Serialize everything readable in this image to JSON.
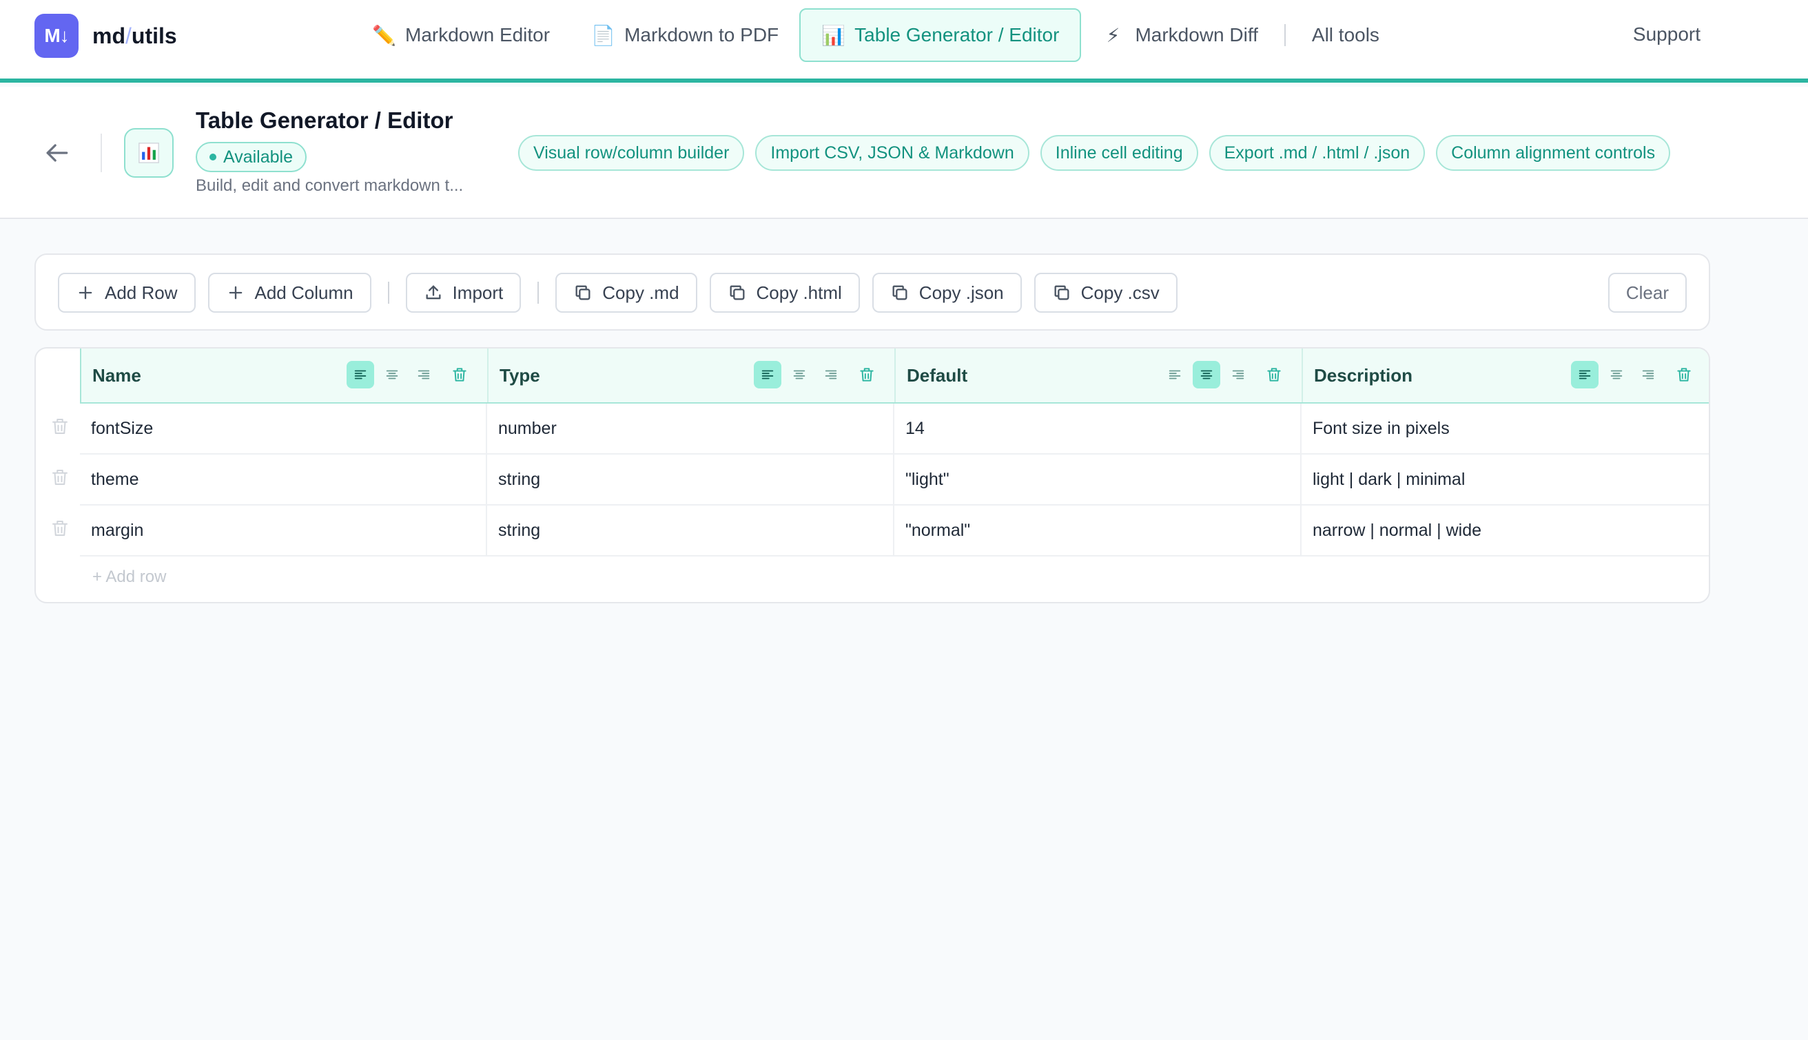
{
  "brand": {
    "logo_text": "M↓",
    "name_part1": "md",
    "name_sep": "/",
    "name_part2": "utils"
  },
  "nav": {
    "items": [
      {
        "label": "Markdown Editor",
        "icon": "✏️"
      },
      {
        "label": "Markdown to PDF",
        "icon": "📄"
      },
      {
        "label": "Table Generator / Editor",
        "icon": "📊"
      },
      {
        "label": "Markdown Diff",
        "icon": "⚡"
      }
    ],
    "all_tools": "All tools",
    "support": "Support"
  },
  "tool": {
    "title": "Table Generator / Editor",
    "status": "Available",
    "description": "Build, edit and convert markdown t...",
    "features": [
      "Visual row/column builder",
      "Import CSV, JSON & Markdown",
      "Inline cell editing",
      "Export .md / .html / .json",
      "Column alignment controls"
    ]
  },
  "toolbar": {
    "add_row": "Add Row",
    "add_column": "Add Column",
    "import": "Import",
    "copy_md": "Copy .md",
    "copy_html": "Copy .html",
    "copy_json": "Copy .json",
    "copy_csv": "Copy .csv",
    "clear": "Clear"
  },
  "table": {
    "columns": [
      {
        "label": "Name",
        "align": "left"
      },
      {
        "label": "Type",
        "align": "left"
      },
      {
        "label": "Default",
        "align": "center"
      },
      {
        "label": "Description",
        "align": "left"
      }
    ],
    "rows": [
      [
        "fontSize",
        "number",
        "14",
        "Font size in pixels"
      ],
      [
        "theme",
        "string",
        "\"light\"",
        "light | dark | minimal"
      ],
      [
        "margin",
        "string",
        "\"normal\"",
        "narrow | normal | wide"
      ]
    ],
    "add_row_hint": "+ Add row"
  },
  "colors": {
    "accent": "#2bb5a1",
    "brand": "#6366f1",
    "accent_text": "#13927f"
  }
}
